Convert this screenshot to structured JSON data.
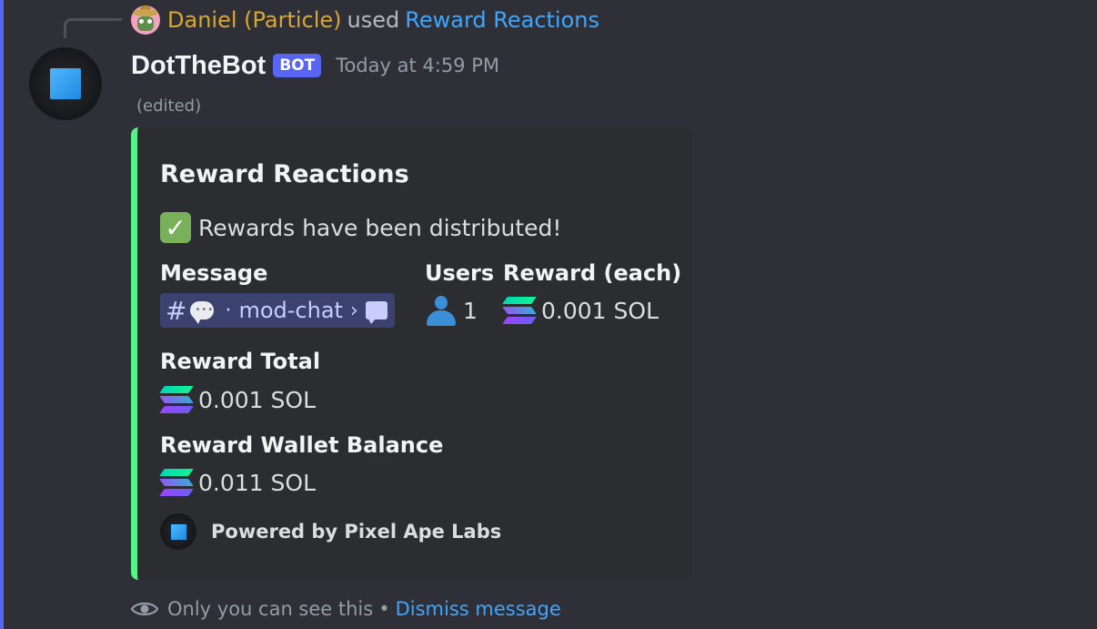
{
  "reply": {
    "user": "Daniel (Particle)",
    "used_text": "used",
    "command": "Reward Reactions"
  },
  "message": {
    "author": "DotTheBot",
    "badge": "BOT",
    "timestamp": "Today at 4:59 PM",
    "edited": "(edited)"
  },
  "embed": {
    "accent_color": "#57f287",
    "title": "Reward Reactions",
    "description_icon": "check-mark-icon",
    "description": "Rewards have been distributed!",
    "fields": {
      "message": {
        "name": "Message",
        "channel_hash": "#",
        "channel_separator": "·",
        "channel_name": "mod-chat",
        "chevron": "›"
      },
      "users": {
        "name": "Users",
        "value": "1"
      },
      "reward_each": {
        "name": "Reward (each)",
        "value": "0.001 SOL"
      },
      "reward_total": {
        "name": "Reward Total",
        "value": "0.001 SOL"
      },
      "wallet_balance": {
        "name": "Reward Wallet Balance",
        "value": "0.011 SOL"
      }
    },
    "footer": "Powered by Pixel Ape Labs"
  },
  "ephemeral": {
    "notice": "Only you can see this",
    "separator": "•",
    "dismiss": "Dismiss message"
  },
  "colors": {
    "background": "#2f3037",
    "embed_background": "#2b2d31",
    "link": "#3ea6ff",
    "reply_username": "#d9a733",
    "bot_badge": "#5865f2",
    "mention_background": "#3c4270"
  }
}
